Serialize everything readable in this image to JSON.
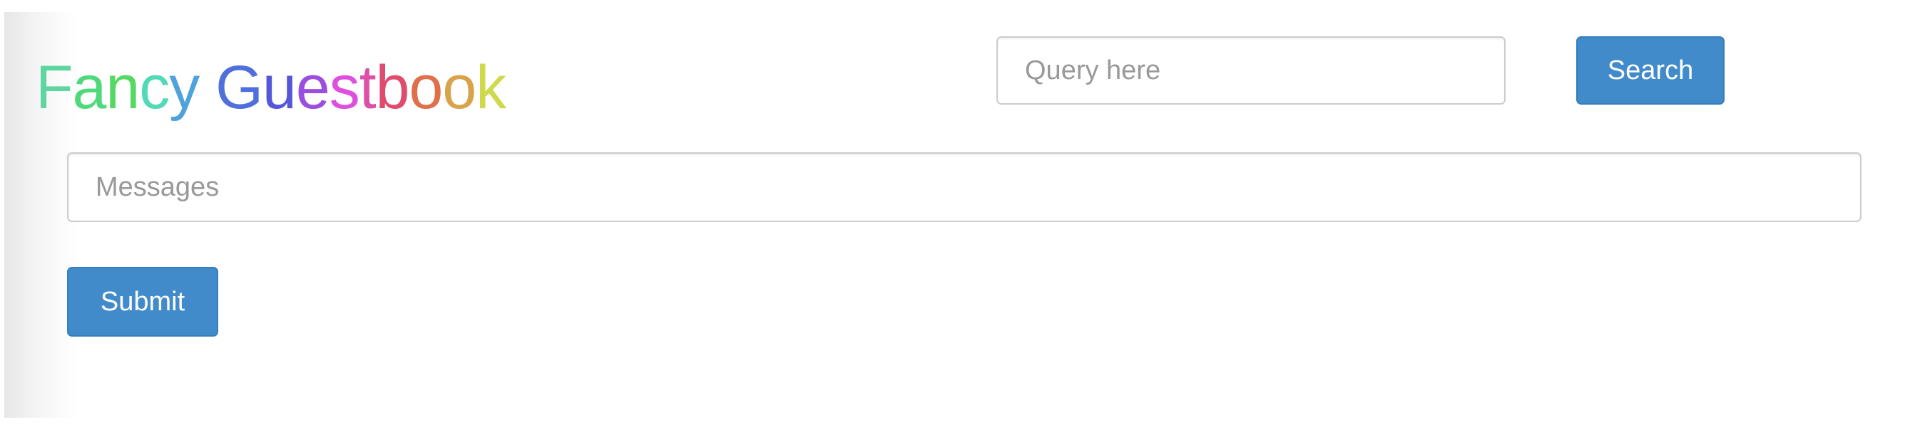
{
  "header": {
    "brand": {
      "letters": [
        {
          "ch": "F",
          "color": "#5ed6a0"
        },
        {
          "ch": "a",
          "color": "#4fd97a"
        },
        {
          "ch": "n",
          "color": "#54da63"
        },
        {
          "ch": "c",
          "color": "#52d9b6"
        },
        {
          "ch": "y",
          "color": "#4fa3dc"
        },
        {
          "ch": " ",
          "color": "#ffffff"
        },
        {
          "ch": "G",
          "color": "#4f6fdc"
        },
        {
          "ch": "u",
          "color": "#5656d9"
        },
        {
          "ch": "e",
          "color": "#9b4fde"
        },
        {
          "ch": "s",
          "color": "#de4fde"
        },
        {
          "ch": "t",
          "color": "#de4fa8"
        },
        {
          "ch": "b",
          "color": "#df4c6e"
        },
        {
          "ch": "o",
          "color": "#e0704c"
        },
        {
          "ch": "o",
          "color": "#d9a34c"
        },
        {
          "ch": "k",
          "color": "#cfd94c"
        }
      ]
    },
    "search": {
      "placeholder": "Query here",
      "value": "",
      "button_label": "Search"
    }
  },
  "form": {
    "message": {
      "placeholder": "Messages",
      "value": ""
    },
    "submit_label": "Submit"
  },
  "colors": {
    "button_primary": "#428bca",
    "button_border": "#357ebd",
    "input_border": "#cccccc",
    "placeholder": "#999999"
  }
}
